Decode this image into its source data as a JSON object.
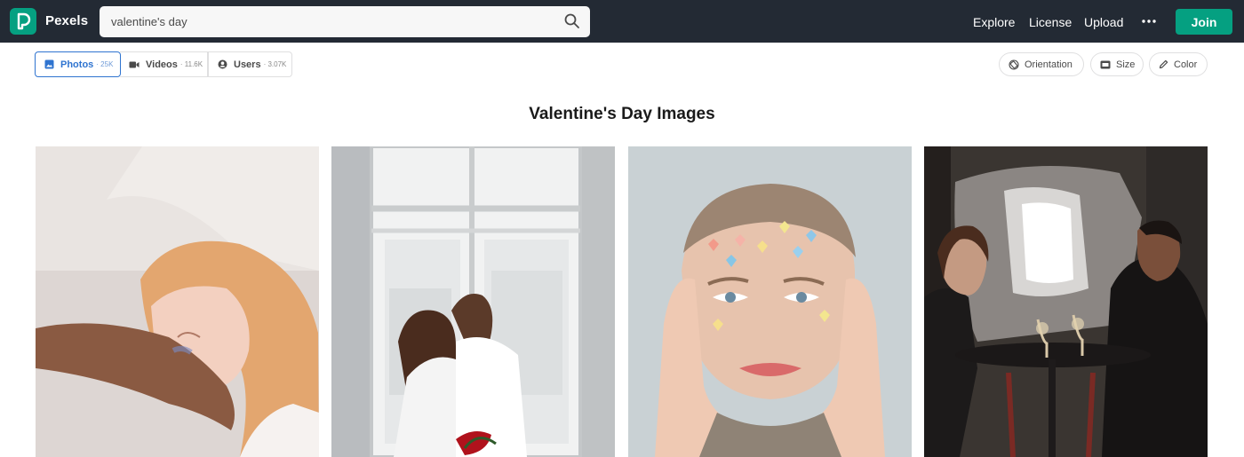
{
  "app": {
    "brand": "Pexels"
  },
  "search": {
    "query": "valentine's day",
    "icon": "search-icon"
  },
  "nav": {
    "explore": "Explore",
    "license": "License",
    "upload": "Upload",
    "more_icon": "more-dots-icon",
    "join": "Join"
  },
  "tabs": [
    {
      "label": "Photos",
      "count": "· 25K",
      "icon": "image-icon",
      "active": true
    },
    {
      "label": "Videos",
      "count": "· 11.6K",
      "icon": "video-icon",
      "active": false
    },
    {
      "label": "Users",
      "count": "· 3.07K",
      "icon": "user-icon",
      "active": false
    }
  ],
  "filters": {
    "orientation": "Orientation",
    "size": "Size",
    "color": "Color"
  },
  "heading": "Valentine's Day Images",
  "colors": {
    "topbar": "#232a34",
    "brand": "#05a081",
    "active_tab": "#2f74d0"
  }
}
